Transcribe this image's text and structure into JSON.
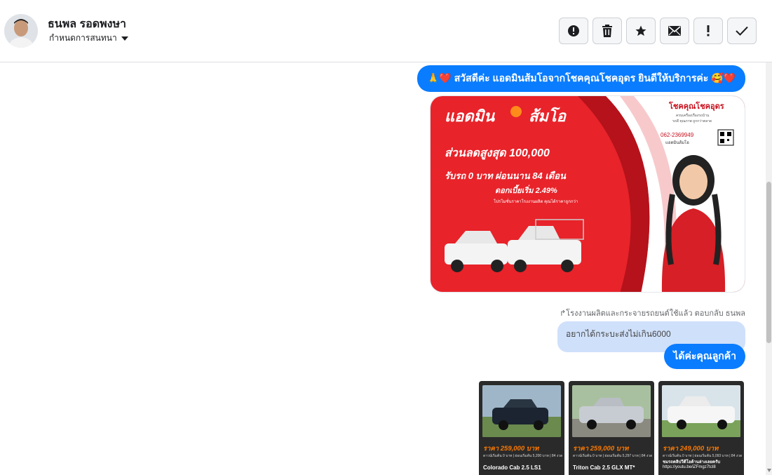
{
  "header": {
    "contact_name": "ธนพล รอดพงษา",
    "assign_label": "กำหนดการสนทนา",
    "actions": [
      {
        "name": "mark-spam-button",
        "icon": "alert-circle-icon"
      },
      {
        "name": "delete-button",
        "icon": "trash-icon"
      },
      {
        "name": "star-button",
        "icon": "star-icon"
      },
      {
        "name": "mark-unread-button",
        "icon": "envelope-icon"
      },
      {
        "name": "follow-up-button",
        "icon": "exclamation-icon"
      },
      {
        "name": "mark-done-button",
        "icon": "check-icon"
      }
    ]
  },
  "messages": {
    "greeting": "🙏❤️ สวัสดีค่ะ แอดมินส้มโอจากโชคคุณโชคอุดร ยินดีให้บริการค่ะ 🥰❤️",
    "promo": {
      "admin_label": "แอดมิน",
      "admin_name": "ส้มโอ",
      "dealer": "โชคคุณโชคอุดร",
      "dealer_sub1": "ครบเครื่องเรื่องรถบ้าน",
      "dealer_sub2": "รถดี คุณภาพ ถูกกว่าตลาด",
      "phone": "062-2369949",
      "phone_label": "แอดมินส้มโอ",
      "discount": "ส่วนลดสูงสุด 100,000",
      "down": "รับรถ 0 บาท ผ่อนนาน 84 เดือน",
      "interest": "ดอกเบี้ยเริ่ม 2.49%",
      "fine": "โปรโมชั่นราคาโรงงานผลิต คุณได้ราคาถูกกว่า"
    },
    "reply_note": "↱โรงงานผลิตและกระจายรถยนต์ใช้แล้ว ตอบกลับ ธนพล",
    "quoted": "อยากได้กระบะส่งไม่เกิน6000",
    "reply": "ได้ค่ะคุณลูกค้า",
    "cards": [
      {
        "price": "ราคา 259,000 บาท",
        "sub": "ดาวน์เริ่มต้น 0 บาท | ผ่อนเริ่มต้น 5,200 บาท | 84 งวด",
        "title": "Colorado Cab 2.5 LS1",
        "link": ""
      },
      {
        "price": "ราคา 259,000 บาท",
        "sub": "ดาวน์เริ่มต้น 0 บาท | ผ่อนเริ่มต้น 5,297 บาท | 84 งวด",
        "title": "Triton Cab 2.5 GLX MT*",
        "link": ""
      },
      {
        "price": "ราคา 249,000 บาท",
        "sub": "ดาวน์เริ่มต้น 0 บาท | ผ่อนเริ่มต้น 5,093 บาท | 84 งวด",
        "title": "ชมรถคลิปวีดีโอด้านล่างเลยครับ",
        "link": "https://youtu.be/iZFmgz7tcI8"
      }
    ]
  },
  "colors": {
    "accent": "#0a7cff",
    "quoted_bg": "#cfe0fa",
    "promo_red": "#e8232a",
    "price_orange": "#ff7a00"
  }
}
